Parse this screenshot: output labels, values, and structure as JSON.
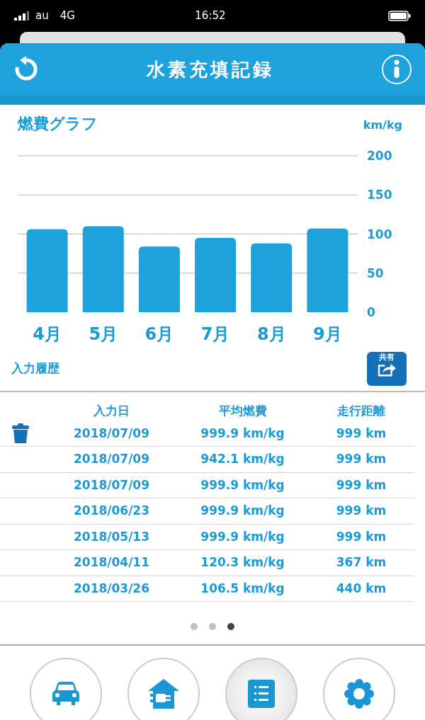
{
  "status_bar": {
    "carrier": "au",
    "network": "4G",
    "time": "16:52"
  },
  "header": {
    "title": "水素充填記録"
  },
  "chart": {
    "chart_data": {
      "type": "bar",
      "title": "燃費グラフ",
      "ylabel": "km/kg",
      "categories": [
        "4月",
        "5月",
        "6月",
        "7月",
        "8月",
        "9月"
      ],
      "values": [
        106,
        110,
        84,
        95,
        88,
        107
      ],
      "ylim": [
        0,
        200
      ],
      "yticks": [
        0,
        50,
        100,
        150,
        200
      ],
      "grid": true
    }
  },
  "history": {
    "title": "入力履歴",
    "share_label": "共有",
    "columns": [
      "入力日",
      "平均燃費",
      "走行距離"
    ],
    "rows": [
      {
        "date": "2018/07/09",
        "fuel": "999.9 km/kg",
        "distance": "999 km"
      },
      {
        "date": "2018/07/09",
        "fuel": "942.1 km/kg",
        "distance": "999 km"
      },
      {
        "date": "2018/07/09",
        "fuel": "999.9 km/kg",
        "distance": "999 km"
      },
      {
        "date": "2018/06/23",
        "fuel": "999.9 km/kg",
        "distance": "999 km"
      },
      {
        "date": "2018/05/13",
        "fuel": "999.9 km/kg",
        "distance": "999 km"
      },
      {
        "date": "2018/04/11",
        "fuel": "120.3 km/kg",
        "distance": "367 km"
      },
      {
        "date": "2018/03/26",
        "fuel": "106.5 km/kg",
        "distance": "440 km"
      }
    ]
  },
  "pager": [
    {
      "selected": false
    },
    {
      "selected": false
    },
    {
      "selected": true
    }
  ],
  "nav": [
    {
      "kind": "car",
      "selected": false
    },
    {
      "kind": "home",
      "selected": false
    },
    {
      "kind": "list",
      "selected": true
    },
    {
      "kind": "settings",
      "selected": false
    }
  ]
}
